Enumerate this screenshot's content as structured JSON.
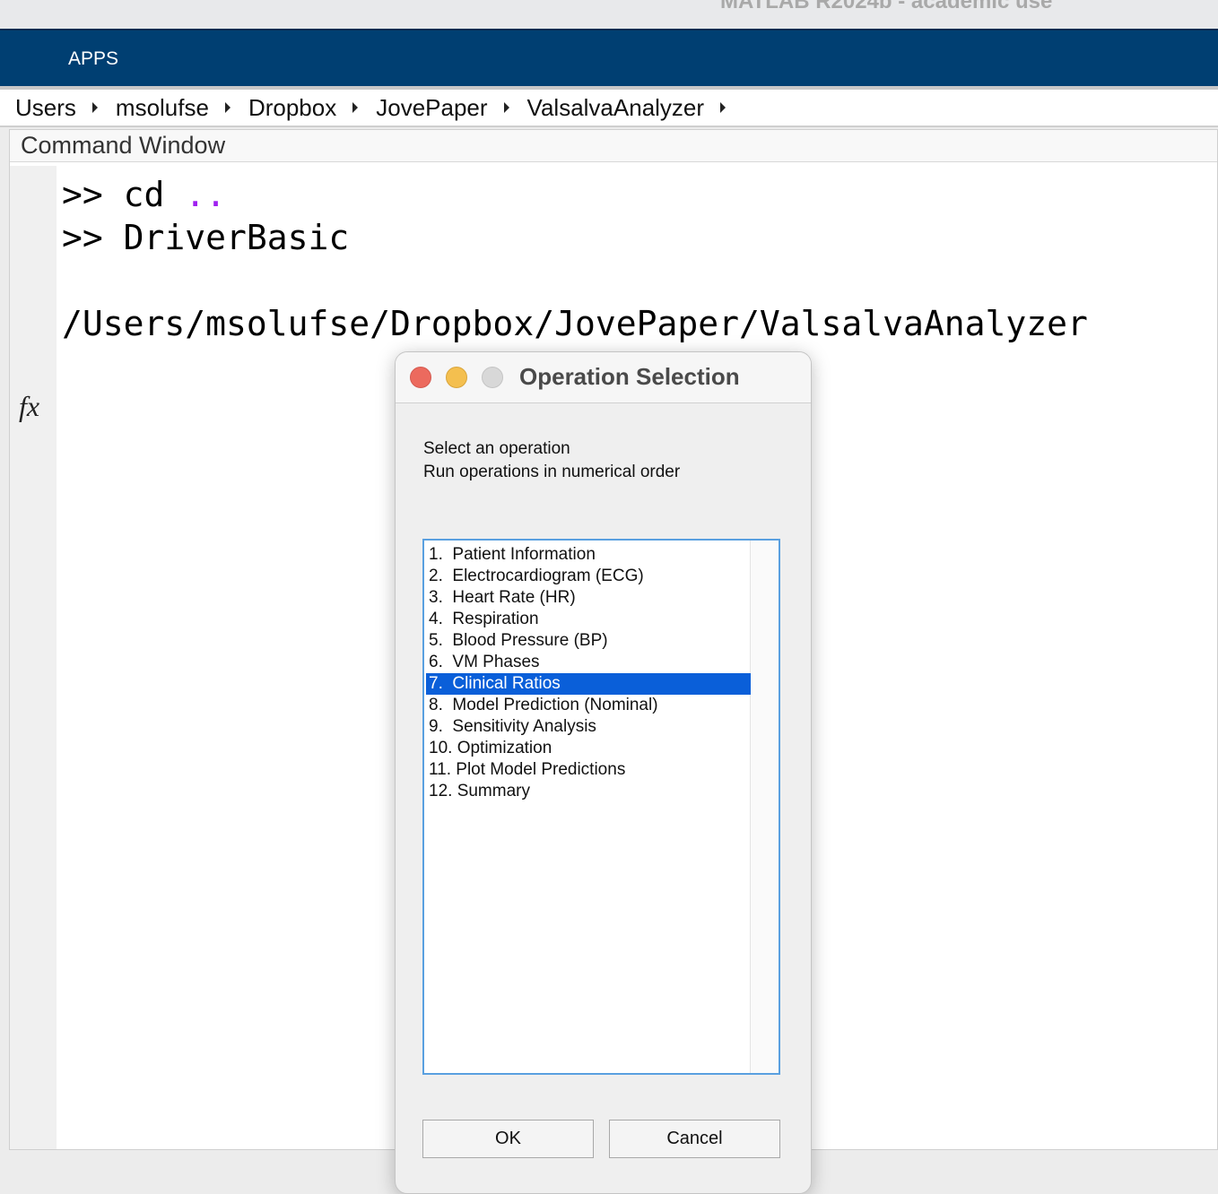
{
  "window_title": "MATLAB R2024b - academic use",
  "ribbon": {
    "tab": "APPS"
  },
  "breadcrumb": [
    "Users",
    "msolufse",
    "Dropbox",
    "JovePaper",
    "ValsalvaAnalyzer"
  ],
  "command_window": {
    "title": "Command Window",
    "lines": [
      {
        "prompt": ">> ",
        "cmd": "cd ",
        "arg": ".."
      },
      {
        "prompt": ">> ",
        "cmd": "DriverBasic"
      },
      {
        "output": "/Users/msolufse/Dropbox/JovePaper/ValsalvaAnalyzer"
      }
    ],
    "fx_icon": "function-browser-icon"
  },
  "dialog": {
    "title": "Operation Selection",
    "prompt_line1": "Select an operation",
    "prompt_line2": "Run operations in numerical order",
    "items": [
      "1.  Patient Information",
      "2.  Electrocardiogram (ECG)",
      "3.  Heart Rate (HR)",
      "4.  Respiration",
      "5.  Blood Pressure (BP)",
      "6.  VM Phases",
      "7.  Clinical Ratios",
      "8.  Model Prediction (Nominal)",
      "9.  Sensitivity Analysis",
      "10. Optimization",
      "11. Plot Model Predictions",
      "12. Summary"
    ],
    "selected_index": 6,
    "ok_label": "OK",
    "cancel_label": "Cancel",
    "colors": {
      "selection": "#0a5fd9",
      "close": "#ec6a5e",
      "minimize": "#f4bf4f",
      "zoom_disabled": "#d8d8d8"
    }
  }
}
